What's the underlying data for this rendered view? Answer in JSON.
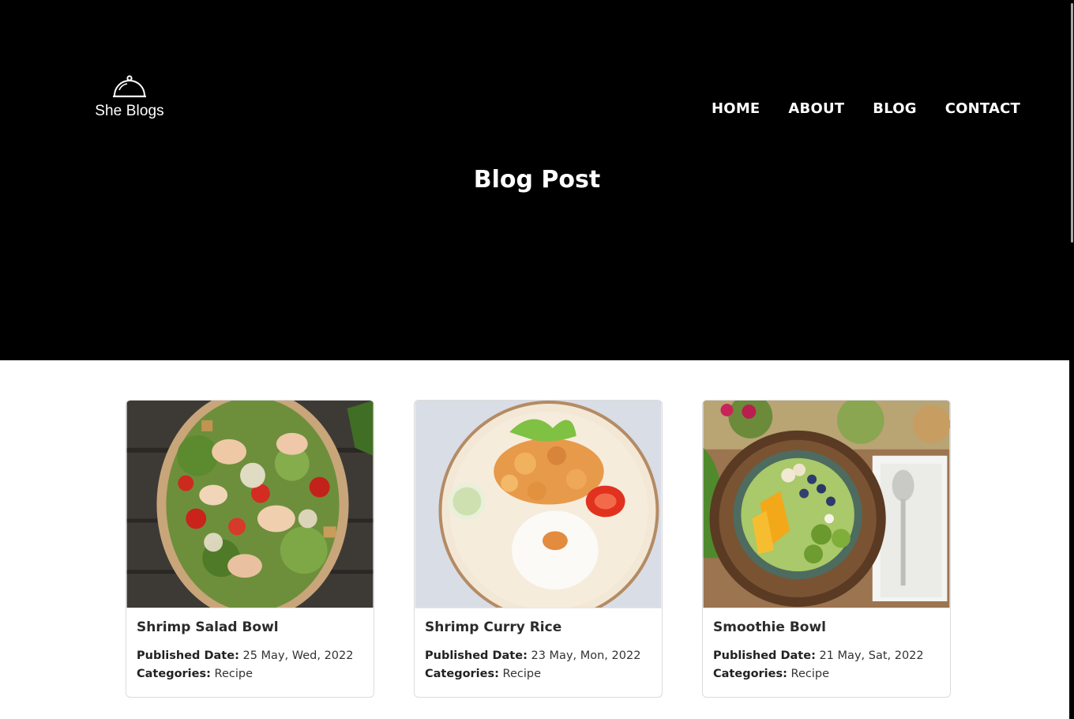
{
  "brand": {
    "name": "She Blogs",
    "logo_icon": "cloche-icon"
  },
  "nav": {
    "items": [
      "HOME",
      "ABOUT",
      "BLOG",
      "CONTACT"
    ]
  },
  "hero": {
    "title": "Blog Post"
  },
  "posts": [
    {
      "title": "Shrimp Salad Bowl",
      "published_label": "Published Date:",
      "published_value": "25 May, Wed, 2022",
      "categories_label": "Categories:",
      "categories_value": "Recipe"
    },
    {
      "title": "Shrimp Curry Rice",
      "published_label": "Published Date:",
      "published_value": "23 May, Mon, 2022",
      "categories_label": "Categories:",
      "categories_value": "Recipe"
    },
    {
      "title": "Smoothie Bowl",
      "published_label": "Published Date:",
      "published_value": "21 May, Sat, 2022",
      "categories_label": "Categories:",
      "categories_value": "Recipe"
    }
  ],
  "colors": {
    "header_bg": "#000000",
    "text_on_dark": "#ffffff",
    "card_border": "#dcdcdc"
  }
}
